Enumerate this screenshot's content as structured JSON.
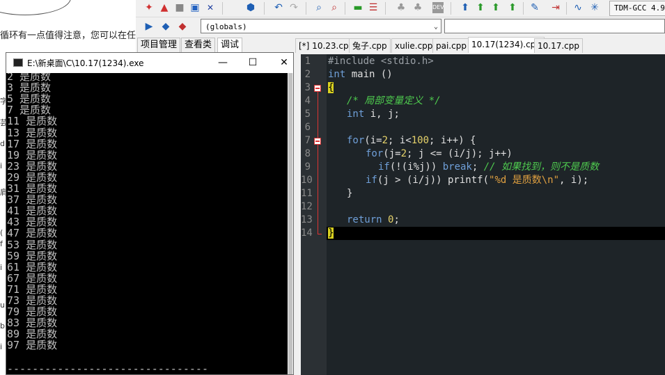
{
  "browser": {
    "text_fragment": "循环有一点值得注意，您可以在任",
    "edge_chars": [
      "字",
      "芸",
      "d",
      "i",
      "肩",
      "(",
      "f",
      "i",
      "u",
      "b",
      "i"
    ]
  },
  "toolbar": {
    "icons": [
      "new-file-icon",
      "open-file-icon",
      "save-icon",
      "save-all-icon",
      "close-icon",
      "print-icon",
      "undo-icon",
      "redo-icon",
      "find-icon",
      "replace-icon",
      "goto-icon",
      "compile-icon",
      "run-icon",
      "compile-run-icon",
      "rebuild-icon",
      "debug-icon",
      "stop-icon",
      "profile-icon",
      "chart-icon",
      "bookmark-icon",
      "dev-icon"
    ],
    "compiler": "TDM-GCC 4.9"
  },
  "scope": {
    "value": "(globals)"
  },
  "panel_tabs": [
    {
      "label": "项目管理",
      "active": false
    },
    {
      "label": "查看类",
      "active": false
    },
    {
      "label": "调试",
      "active": true
    }
  ],
  "file_tabs": [
    {
      "label": "[*] 10.23.cpp",
      "active": false
    },
    {
      "label": "兔子.cpp",
      "active": false
    },
    {
      "label": "xulie.cpp",
      "active": false
    },
    {
      "label": "pai.cpp",
      "active": false
    },
    {
      "label": "10.17(1234).cpp",
      "active": true
    },
    {
      "label": "10.17.cpp",
      "active": false
    }
  ],
  "editor": {
    "line_numbers": [
      "1",
      "2",
      "3",
      "4",
      "5",
      "6",
      "7",
      "8",
      "9",
      "10",
      "11",
      "12",
      "13",
      "14"
    ],
    "lines": {
      "l1_pp": "#include <stdio.h>",
      "l2_kw": "int",
      "l2_rest": " main ()",
      "l3": "{",
      "l4_comment": "/* 局部变量定义 */",
      "l5_kw": "int",
      "l5_rest": " i, j;",
      "l7_for": "for",
      "l7_a": "(i=",
      "l7_n1": "2",
      "l7_b": "; i<",
      "l7_n2": "100",
      "l7_c": "; i++) {",
      "l8_for": "for",
      "l8_a": "(j=",
      "l8_n1": "2",
      "l8_b": "; j <= (i/j); j++)",
      "l9_if": "if",
      "l9_a": "(!(i%j)) ",
      "l9_break": "break",
      "l9_b": "; ",
      "l9_comment": "// 如果找到，则不是质数",
      "l10_if": "if",
      "l10_a": "(j > (i/j)) printf(",
      "l10_str": "\"%d 是质数\\n\"",
      "l10_b": ", i);",
      "l11": "}",
      "l13_kw": "return",
      "l13_sp": " ",
      "l13_n": "0",
      "l13_b": ";",
      "l14": "}"
    }
  },
  "console": {
    "title": "E:\\新桌面\\C\\10.17(1234).exe",
    "minimize": "—",
    "maximize": "☐",
    "close": "✕",
    "output": [
      "2 是质数",
      "3 是质数",
      "5 是质数",
      "7 是质数",
      "11 是质数",
      "13 是质数",
      "17 是质数",
      "19 是质数",
      "23 是质数",
      "29 是质数",
      "31 是质数",
      "37 是质数",
      "41 是质数",
      "43 是质数",
      "47 是质数",
      "53 是质数",
      "59 是质数",
      "61 是质数",
      "67 是质数",
      "71 是质数",
      "73 是质数",
      "79 是质数",
      "83 是质数",
      "89 是质数",
      "97 是质数"
    ],
    "separator": "--------------------------------"
  }
}
